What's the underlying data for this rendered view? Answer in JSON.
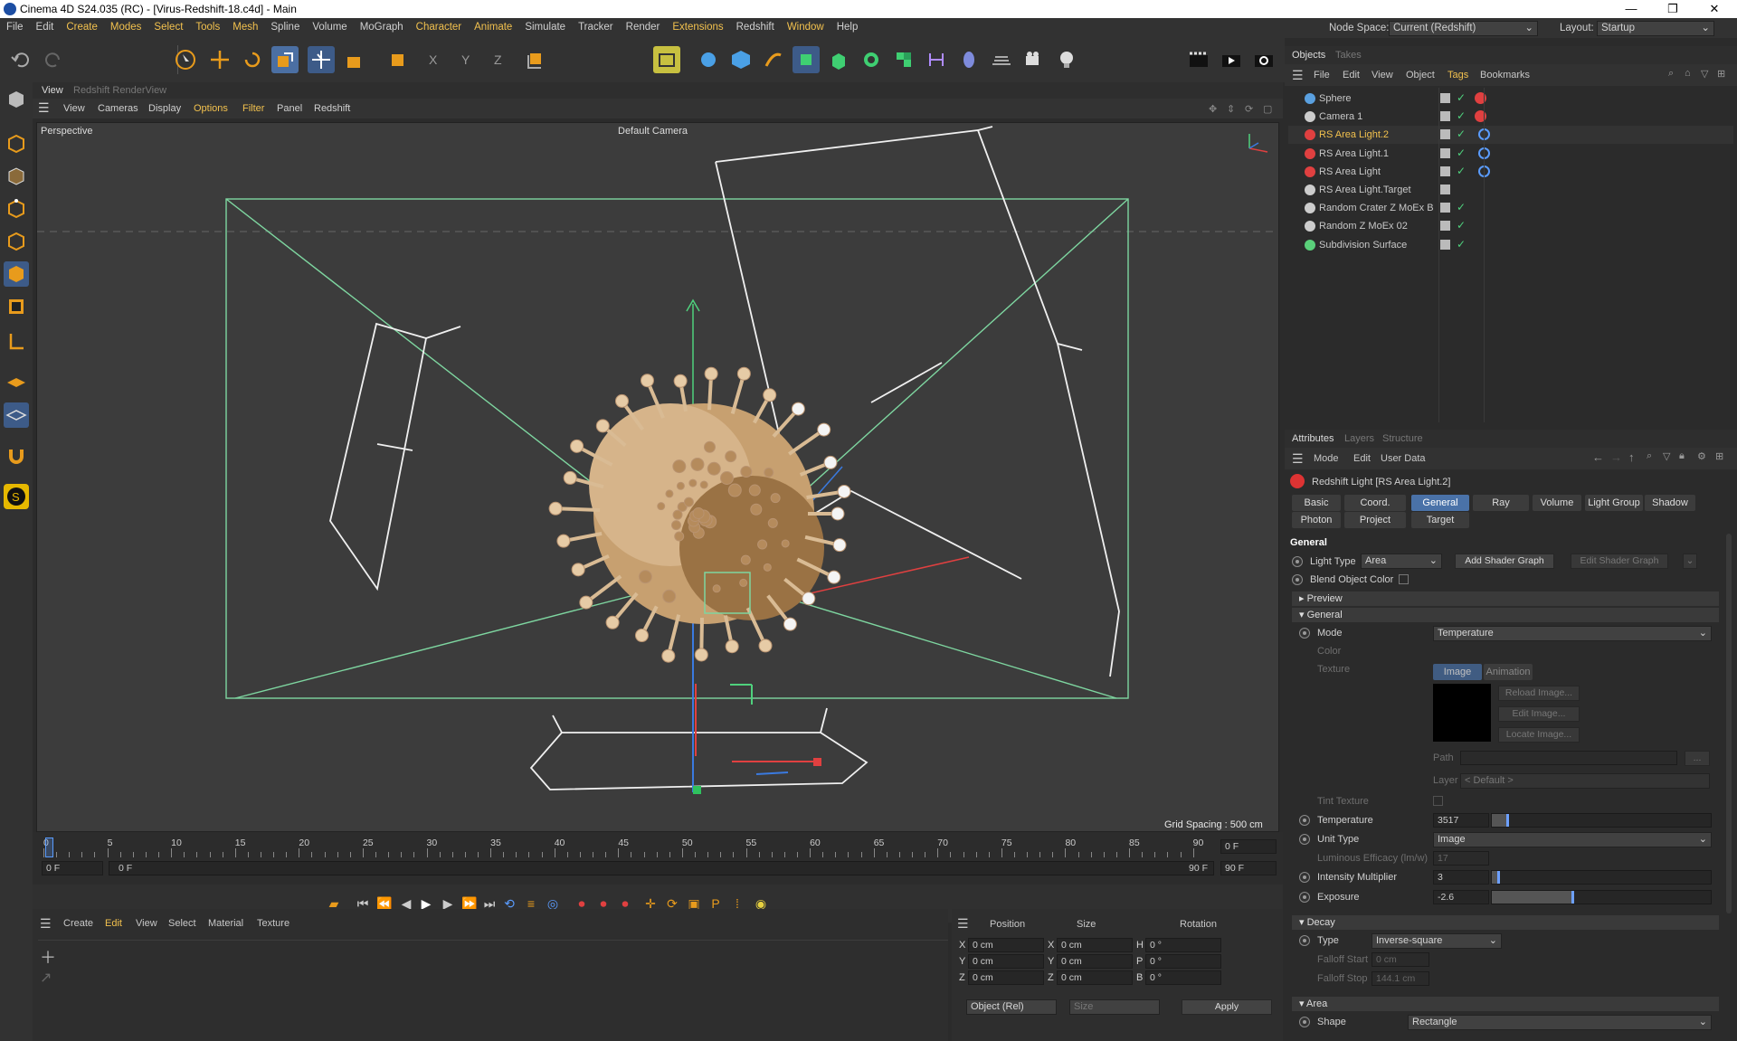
{
  "title_bar": {
    "title": "Cinema 4D S24.035 (RC) - [Virus-Redshift-18.c4d] - Main",
    "minimize": "—",
    "maximize": "❐",
    "close": "✕"
  },
  "menubar": {
    "items": [
      "File",
      "Edit",
      "Create",
      "Modes",
      "Select",
      "Tools",
      "Mesh",
      "Spline",
      "Volume",
      "MoGraph",
      "Character",
      "Animate",
      "Simulate",
      "Tracker",
      "Render",
      "Extensions",
      "Redshift",
      "Window",
      "Help"
    ],
    "node_space_label": "Node Space:",
    "node_space_value": "Current (Redshift)",
    "layout_label": "Layout:",
    "layout_value": "Startup"
  },
  "view_tabs": {
    "view": "View",
    "rs_renderview": "Redshift RenderView"
  },
  "view_menu": [
    "View",
    "Cameras",
    "Display",
    "Options",
    "Filter",
    "Panel",
    "Redshift"
  ],
  "viewport": {
    "projection": "Perspective",
    "camera": "Default Camera",
    "grid_spacing": "Grid Spacing : 500 cm"
  },
  "timeline": {
    "ticks": [
      "0",
      "5",
      "10",
      "15",
      "20",
      "25",
      "30",
      "35",
      "40",
      "45",
      "50",
      "55",
      "60",
      "65",
      "70",
      "75",
      "80",
      "85",
      "90"
    ],
    "current_frame": "0 F",
    "start_frame": "0 F",
    "range_label": "0 F",
    "range_end_label": "90 F",
    "end_frame": "90 F",
    "max_frame": "90 F"
  },
  "material_menu": [
    "Create",
    "Edit",
    "View",
    "Select",
    "Material",
    "Texture"
  ],
  "coords": {
    "headers": [
      "Position",
      "Size",
      "Rotation"
    ],
    "rows": [
      {
        "axis": "X",
        "pos": "0 cm",
        "sizeaxis": "X",
        "size": "0 cm",
        "rotaxis": "H",
        "rot": "0 °"
      },
      {
        "axis": "Y",
        "pos": "0 cm",
        "sizeaxis": "Y",
        "size": "0 cm",
        "rotaxis": "P",
        "rot": "0 °"
      },
      {
        "axis": "Z",
        "pos": "0 cm",
        "sizeaxis": "Z",
        "size": "0 cm",
        "rotaxis": "B",
        "rot": "0 °"
      }
    ],
    "mode": "Object (Rel)",
    "size_mode": "Size",
    "apply": "Apply"
  },
  "objects_panel": {
    "tabs": [
      "Objects",
      "Takes"
    ],
    "menu": [
      "File",
      "Edit",
      "View",
      "Object",
      "Tags",
      "Bookmarks"
    ],
    "items": [
      {
        "name": "Sphere",
        "color": "#5aa0e0"
      },
      {
        "name": "Camera 1",
        "color": "#cccccc"
      },
      {
        "name": "RS Area Light.2",
        "color": "#e04040",
        "selected": true
      },
      {
        "name": "RS Area Light.1",
        "color": "#e04040"
      },
      {
        "name": "RS Area Light",
        "color": "#e04040"
      },
      {
        "name": "RS Area Light.Target",
        "color": "#cccccc"
      },
      {
        "name": "Random Crater Z MoEx B",
        "color": "#cccccc"
      },
      {
        "name": "Random Z MoEx 02",
        "color": "#cccccc"
      },
      {
        "name": "Subdivision Surface",
        "color": "#5ad07a"
      }
    ]
  },
  "attributes_panel": {
    "tabs": [
      "Attributes",
      "Layers",
      "Structure"
    ],
    "menu": [
      "Mode",
      "Edit",
      "User Data"
    ],
    "object_title": "Redshift Light [RS Area Light.2]",
    "tab_row1": [
      "Basic",
      "Coord.",
      "General",
      "Ray",
      "Volume",
      "Light Group",
      "Shadow"
    ],
    "tab_row2": [
      "Photon",
      "Project",
      "Target"
    ],
    "section_general": "General",
    "light_type_label": "Light Type",
    "light_type_value": "Area",
    "add_shader_graph": "Add Shader Graph",
    "edit_shader_graph": "Edit Shader Graph",
    "blend_object_color": "Blend Object Color",
    "preview": "Preview",
    "general_group": "General",
    "mode_label": "Mode",
    "mode_value": "Temperature",
    "color_label": "Color",
    "texture_label": "Texture",
    "image_tab": "Image",
    "animation_tab": "Animation",
    "reload_image": "Reload Image...",
    "edit_image": "Edit Image...",
    "locate_image": "Locate Image...",
    "path_label": "Path",
    "path_button": "...",
    "layer_label": "Layer",
    "layer_value": "< Default >",
    "tint_texture": "Tint Texture",
    "temperature_label": "Temperature",
    "temperature_value": "3517",
    "unit_type_label": "Unit Type",
    "unit_type_value": "Image",
    "luminous_efficacy_label": "Luminous Efficacy (lm/w)",
    "luminous_efficacy_value": "17",
    "intensity_label": "Intensity Multiplier",
    "intensity_value": "3",
    "exposure_label": "Exposure",
    "exposure_value": "-2.6",
    "decay_group": "Decay",
    "type_label": "Type",
    "type_value": "Inverse-square",
    "falloff_start_label": "Falloff Start",
    "falloff_start_value": "0 cm",
    "falloff_stop_label": "Falloff Stop",
    "falloff_stop_value": "144.1 cm",
    "area_group": "Area",
    "shape_label": "Shape",
    "shape_value": "Rectangle"
  }
}
